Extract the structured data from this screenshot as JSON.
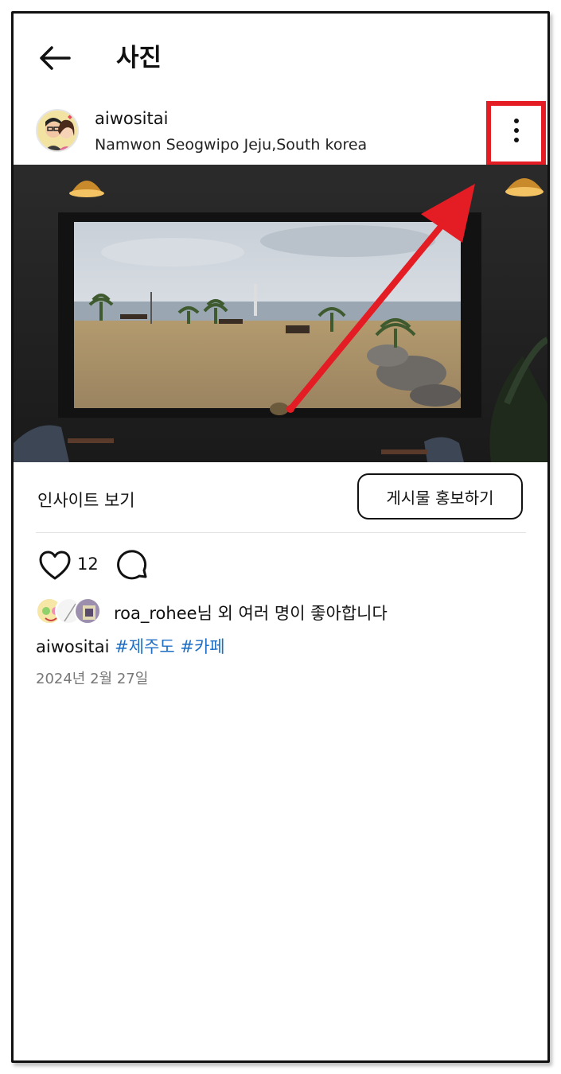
{
  "header": {
    "title": "사진",
    "back_icon": "arrow-left-icon"
  },
  "post": {
    "username": "aiwositai",
    "location": "Namwon Seogwipo Jeju,South korea",
    "more_icon": "more-vertical-icon",
    "highlight_color": "#e41c24"
  },
  "actions": {
    "insight_label": "인사이트 보기",
    "promote_label": "게시물 홍보하기",
    "like_icon": "heart-icon",
    "like_count": "12",
    "comment_icon": "comment-bubble-icon"
  },
  "likes": {
    "first_liker": "roa_rohee",
    "suffix": "님 외 여러 명이 좋아합니다"
  },
  "caption": {
    "author": "aiwositai",
    "tags": [
      "#제주도",
      "#카페"
    ],
    "tag_color": "#1f6fc4"
  },
  "date": "2024년 2월 27일"
}
